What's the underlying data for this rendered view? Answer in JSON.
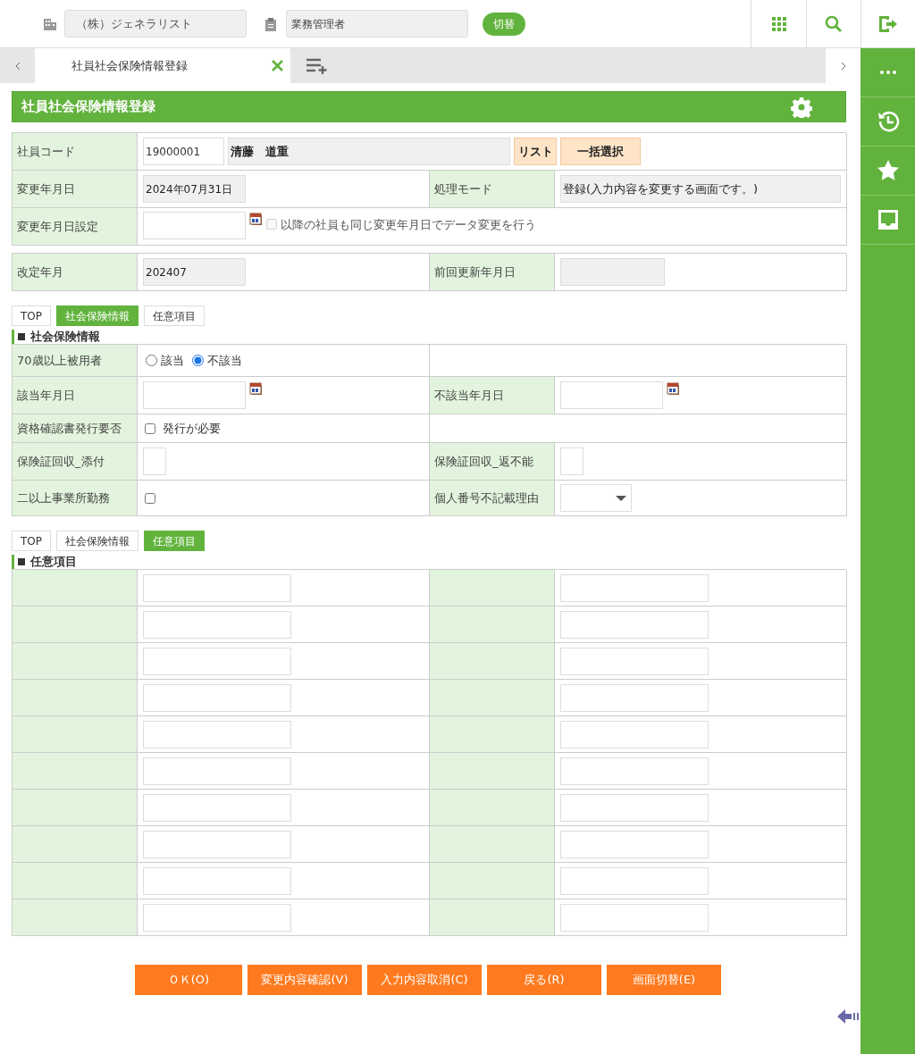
{
  "header": {
    "company": "（株）ジェネラリスト",
    "role": "業務管理者",
    "switch_button": "切替"
  },
  "tabs": [
    {
      "label": "社員社会保険情報登録",
      "selected": true
    }
  ],
  "page_title": "社員社会保険情報登録",
  "employee": {
    "label": "社員コード",
    "code": "19000001",
    "name": "清藤　道重",
    "buttons": [
      "リスト",
      "一括選択"
    ]
  },
  "change_date": {
    "label": "変更年月日",
    "value": "2024年07月31日"
  },
  "mode": {
    "label": "処理モード",
    "value": "登録(入力内容を変更する画面です。)"
  },
  "change_date_setting": {
    "label": "変更年月日設定",
    "checkbox_label": "以降の社員も同じ変更年月日でデータ変更を行う",
    "checked": false,
    "disabled": true
  },
  "revision": {
    "label": "改定年月",
    "value": "202407"
  },
  "last_update": {
    "label": "前回更新年月日"
  },
  "sections": [
    {
      "anchors": [
        {
          "label": "TOP",
          "selected": false
        },
        {
          "label": "社会保険情報",
          "selected": true
        },
        {
          "label": "任意項目",
          "selected": false
        }
      ],
      "title": "社会保険情報",
      "rows": [
        {
          "cells": [
            {
              "kind": "label",
              "text": "70歳以上被用者"
            },
            {
              "kind": "radio",
              "options": [
                {
                  "label": "該当",
                  "selected": false
                },
                {
                  "label": "不該当",
                  "selected": true
                }
              ]
            },
            {
              "kind": "blank"
            }
          ]
        },
        {
          "cells": [
            {
              "kind": "label",
              "text": "該当年月日"
            },
            {
              "kind": "date"
            },
            {
              "kind": "label",
              "text": "不該当年月日"
            },
            {
              "kind": "date"
            }
          ]
        },
        {
          "cells": [
            {
              "kind": "label",
              "text": "資格確認書発行要否"
            },
            {
              "kind": "check",
              "label": "発行が必要",
              "checked": false
            },
            {
              "kind": "blank"
            }
          ]
        },
        {
          "cells": [
            {
              "kind": "label",
              "text": "保険証回収_添付"
            },
            {
              "kind": "box"
            },
            {
              "kind": "label",
              "text": "保険証回収_返不能"
            },
            {
              "kind": "box"
            }
          ]
        },
        {
          "cells": [
            {
              "kind": "label",
              "text": "二以上事業所勤務"
            },
            {
              "kind": "check",
              "checked": false
            },
            {
              "kind": "label",
              "text": "個人番号不記載理由"
            },
            {
              "kind": "select"
            }
          ]
        }
      ]
    },
    {
      "anchors": [
        {
          "label": "TOP",
          "selected": false
        },
        {
          "label": "社会保険情報",
          "selected": false
        },
        {
          "label": "任意項目",
          "selected": true
        }
      ],
      "title": "任意項目",
      "rows": [
        {
          "cells": [
            {
              "kind": "label"
            },
            {
              "kind": "text"
            },
            {
              "kind": "label"
            },
            {
              "kind": "text"
            }
          ]
        },
        {
          "cells": [
            {
              "kind": "label"
            },
            {
              "kind": "text"
            },
            {
              "kind": "label"
            },
            {
              "kind": "text"
            }
          ]
        },
        {
          "cells": [
            {
              "kind": "label"
            },
            {
              "kind": "text"
            },
            {
              "kind": "label"
            },
            {
              "kind": "text"
            }
          ]
        },
        {
          "cells": [
            {
              "kind": "label"
            },
            {
              "kind": "text"
            },
            {
              "kind": "label"
            },
            {
              "kind": "text"
            }
          ]
        },
        {
          "cells": [
            {
              "kind": "label"
            },
            {
              "kind": "text"
            },
            {
              "kind": "label"
            },
            {
              "kind": "text"
            }
          ]
        },
        {
          "cells": [
            {
              "kind": "label"
            },
            {
              "kind": "text"
            },
            {
              "kind": "label"
            },
            {
              "kind": "text"
            }
          ]
        },
        {
          "cells": [
            {
              "kind": "label"
            },
            {
              "kind": "text"
            },
            {
              "kind": "label"
            },
            {
              "kind": "text"
            }
          ]
        },
        {
          "cells": [
            {
              "kind": "label"
            },
            {
              "kind": "text"
            },
            {
              "kind": "label"
            },
            {
              "kind": "text"
            }
          ]
        },
        {
          "cells": [
            {
              "kind": "label"
            },
            {
              "kind": "text"
            },
            {
              "kind": "label"
            },
            {
              "kind": "text"
            }
          ]
        },
        {
          "cells": [
            {
              "kind": "label"
            },
            {
              "kind": "text"
            },
            {
              "kind": "label"
            },
            {
              "kind": "text"
            }
          ]
        }
      ]
    }
  ],
  "actions": [
    "ＯＫ(O)",
    "変更内容確認(V)",
    "入力内容取消(C)",
    "戻る(R)",
    "画面切替(E)"
  ]
}
